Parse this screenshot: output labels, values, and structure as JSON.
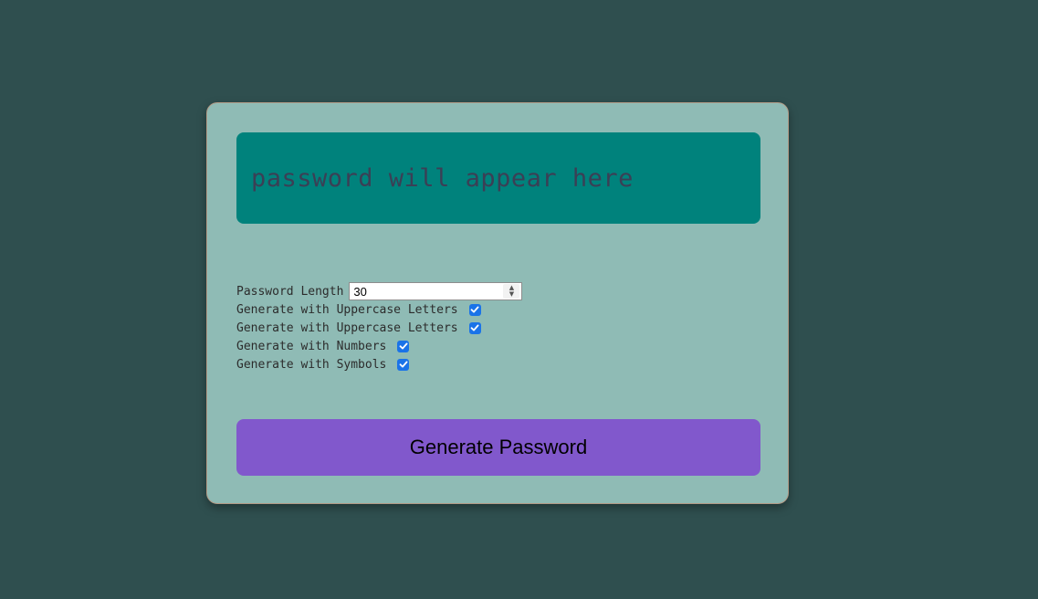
{
  "output": {
    "placeholder": "password will appear here"
  },
  "options": {
    "length_label": "Password Length",
    "length_value": "30",
    "checkboxes": [
      {
        "label": "Generate with Uppercase Letters",
        "checked": true
      },
      {
        "label": "Generate with Uppercase Letters",
        "checked": true
      },
      {
        "label": "Generate with Numbers",
        "checked": true
      },
      {
        "label": "Generate with Symbols",
        "checked": true
      }
    ]
  },
  "actions": {
    "generate_label": "Generate Password"
  },
  "colors": {
    "page_background": "#2f4f4f",
    "card_background": "#8fbbb5",
    "output_background": "#00827c",
    "button_background": "#8158cc",
    "checkbox_accent": "#1a73e8"
  }
}
